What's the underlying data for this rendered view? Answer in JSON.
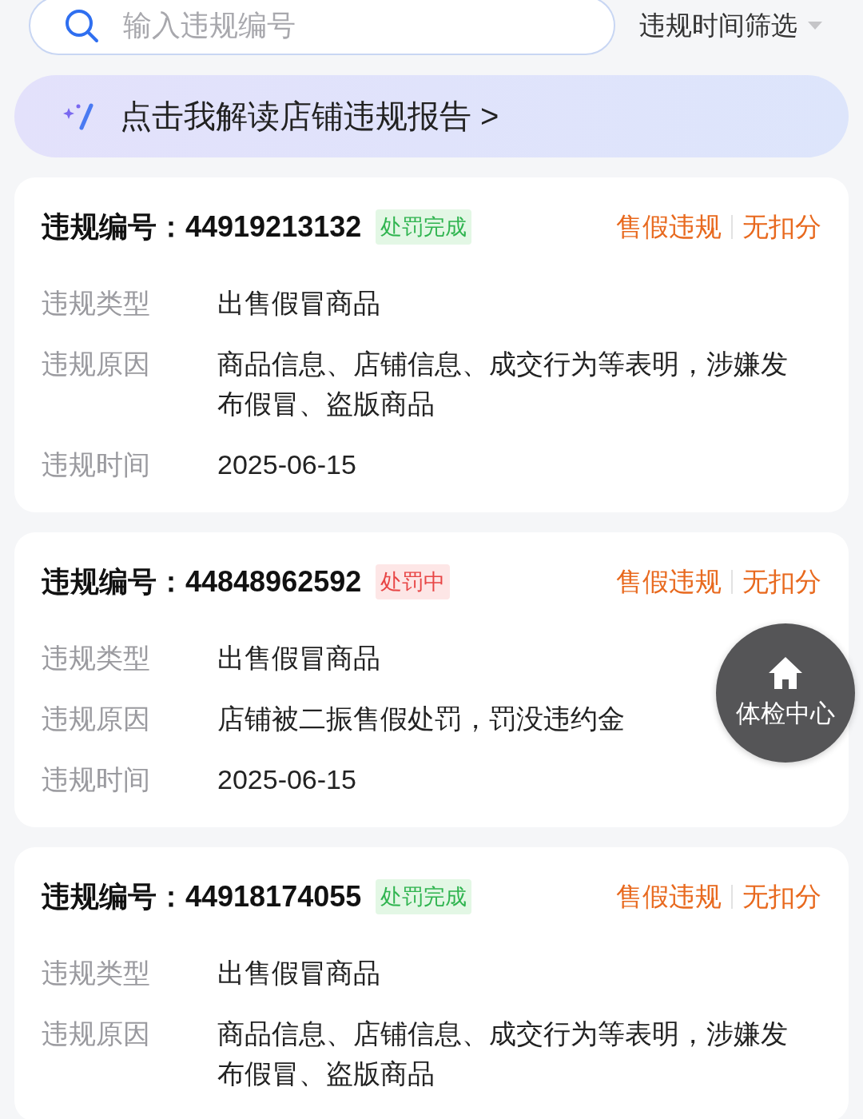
{
  "search": {
    "placeholder": "输入违规编号"
  },
  "time_filter": {
    "label": "违规时间筛选"
  },
  "report_banner": {
    "text": "点击我解读店铺违规报告 >"
  },
  "violations": [
    {
      "id_label": "违规编号：",
      "id": "44919213132",
      "status": "处罚完成",
      "kind": "done",
      "tags": [
        "售假违规",
        "无扣分"
      ],
      "fields": [
        {
          "label": "违规类型",
          "value": "出售假冒商品"
        },
        {
          "label": "违规原因",
          "value": "商品信息、店铺信息、成交行为等表明，涉嫌发布假冒、盗版商品"
        },
        {
          "label": "违规时间",
          "value": "2025-06-15"
        }
      ]
    },
    {
      "id_label": "违规编号：",
      "id": "44848962592",
      "status": "处罚中",
      "kind": "pending",
      "tags": [
        "售假违规",
        "无扣分"
      ],
      "fields": [
        {
          "label": "违规类型",
          "value": "出售假冒商品"
        },
        {
          "label": "违规原因",
          "value": "店铺被二振售假处罚，罚没违约金"
        },
        {
          "label": "违规时间",
          "value": "2025-06-15"
        }
      ]
    },
    {
      "id_label": "违规编号：",
      "id": "44918174055",
      "status": "处罚完成",
      "kind": "done",
      "tags": [
        "售假违规",
        "无扣分"
      ],
      "fields": [
        {
          "label": "违规类型",
          "value": "出售假冒商品"
        },
        {
          "label": "违规原因",
          "value": "商品信息、店铺信息、成交行为等表明，涉嫌发布假冒、盗版商品"
        }
      ]
    }
  ],
  "float_button": {
    "label": "体检中心"
  }
}
